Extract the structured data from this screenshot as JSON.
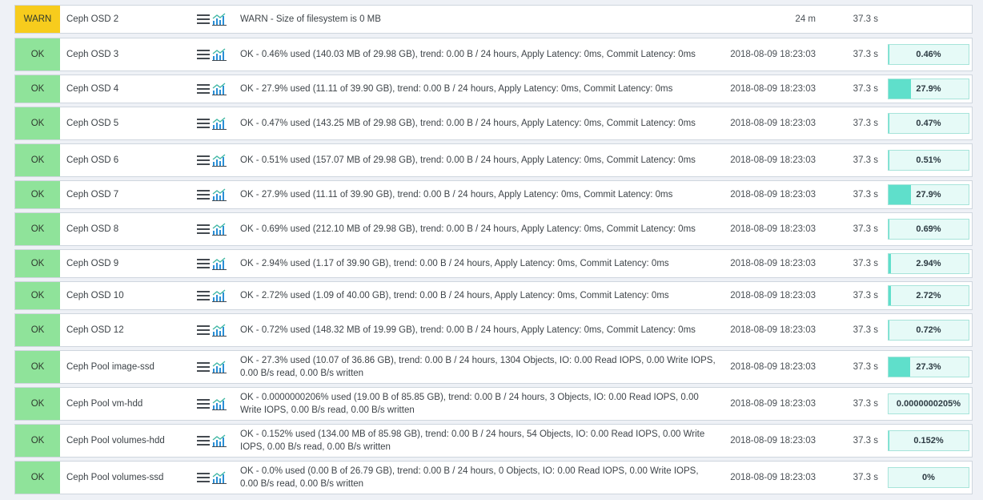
{
  "colors": {
    "ok": "#8fe39a",
    "warn": "#f7cc1d",
    "perf_fill": "#5fdfcb",
    "perf_bg": "#e6faf7"
  },
  "icons": {
    "menu": "hamburger-menu-icon",
    "perf": "perfometer-graph-icon"
  },
  "services": [
    {
      "state": "WARN",
      "name": "Ceph OSD 2",
      "output": "WARN - Size of filesystem is 0 MB",
      "since": "24 m",
      "age": "37.3 s",
      "perf": null
    },
    {
      "state": "OK",
      "name": "Ceph OSD 3",
      "output": "OK - 0.46% used (140.03 MB of 29.98 GB), trend: 0.00 B / 24 hours, Apply Latency: 0ms, Commit Latency: 0ms",
      "since": "2018-08-09 18:23:03",
      "age": "37.3 s",
      "perf": {
        "label": "0.46%",
        "percent": 0.46
      }
    },
    {
      "state": "OK",
      "name": "Ceph OSD 4",
      "output": "OK - 27.9% used (11.11 of 39.90 GB), trend: 0.00 B / 24 hours, Apply Latency: 0ms, Commit Latency: 0ms",
      "since": "2018-08-09 18:23:03",
      "age": "37.3 s",
      "perf": {
        "label": "27.9%",
        "percent": 27.9
      }
    },
    {
      "state": "OK",
      "name": "Ceph OSD 5",
      "output": "OK - 0.47% used (143.25 MB of 29.98 GB), trend: 0.00 B / 24 hours, Apply Latency: 0ms, Commit Latency: 0ms",
      "since": "2018-08-09 18:23:03",
      "age": "37.3 s",
      "perf": {
        "label": "0.47%",
        "percent": 0.47
      }
    },
    {
      "state": "OK",
      "name": "Ceph OSD 6",
      "output": "OK - 0.51% used (157.07 MB of 29.98 GB), trend: 0.00 B / 24 hours, Apply Latency: 0ms, Commit Latency: 0ms",
      "since": "2018-08-09 18:23:03",
      "age": "37.3 s",
      "perf": {
        "label": "0.51%",
        "percent": 0.51
      }
    },
    {
      "state": "OK",
      "name": "Ceph OSD 7",
      "output": "OK - 27.9% used (11.11 of 39.90 GB), trend: 0.00 B / 24 hours, Apply Latency: 0ms, Commit Latency: 0ms",
      "since": "2018-08-09 18:23:03",
      "age": "37.3 s",
      "perf": {
        "label": "27.9%",
        "percent": 27.9
      }
    },
    {
      "state": "OK",
      "name": "Ceph OSD 8",
      "output": "OK - 0.69% used (212.10 MB of 29.98 GB), trend: 0.00 B / 24 hours, Apply Latency: 0ms, Commit Latency: 0ms",
      "since": "2018-08-09 18:23:03",
      "age": "37.3 s",
      "perf": {
        "label": "0.69%",
        "percent": 0.69
      }
    },
    {
      "state": "OK",
      "name": "Ceph OSD 9",
      "output": "OK - 2.94% used (1.17 of 39.90 GB), trend: 0.00 B / 24 hours, Apply Latency: 0ms, Commit Latency: 0ms",
      "since": "2018-08-09 18:23:03",
      "age": "37.3 s",
      "perf": {
        "label": "2.94%",
        "percent": 2.94
      }
    },
    {
      "state": "OK",
      "name": "Ceph OSD 10",
      "output": "OK - 2.72% used (1.09 of 40.00 GB), trend: 0.00 B / 24 hours, Apply Latency: 0ms, Commit Latency: 0ms",
      "since": "2018-08-09 18:23:03",
      "age": "37.3 s",
      "perf": {
        "label": "2.72%",
        "percent": 2.72
      }
    },
    {
      "state": "OK",
      "name": "Ceph OSD 12",
      "output": "OK - 0.72% used (148.32 MB of 19.99 GB), trend: 0.00 B / 24 hours, Apply Latency: 0ms, Commit Latency: 0ms",
      "since": "2018-08-09 18:23:03",
      "age": "37.3 s",
      "perf": {
        "label": "0.72%",
        "percent": 0.72
      }
    },
    {
      "state": "OK",
      "name": "Ceph Pool image-ssd",
      "output": "OK - 27.3% used (10.07 of 36.86 GB), trend: 0.00 B / 24 hours, 1304 Objects, IO: 0.00 Read IOPS, 0.00 Write IOPS, 0.00 B/s read, 0.00 B/s written",
      "since": "2018-08-09 18:23:03",
      "age": "37.3 s",
      "perf": {
        "label": "27.3%",
        "percent": 27.3
      }
    },
    {
      "state": "OK",
      "name": "Ceph Pool vm-hdd",
      "output": "OK - 0.0000000206% used (19.00 B of 85.85 GB), trend: 0.00 B / 24 hours, 3 Objects, IO: 0.00 Read IOPS, 0.00 Write IOPS, 0.00 B/s read, 0.00 B/s written",
      "since": "2018-08-09 18:23:03",
      "age": "37.3 s",
      "perf": {
        "label": "0.0000000205%",
        "percent": 2.05e-08
      }
    },
    {
      "state": "OK",
      "name": "Ceph Pool volumes-hdd",
      "output": "OK - 0.152% used (134.00 MB of 85.98 GB), trend: 0.00 B / 24 hours, 54 Objects, IO: 0.00 Read IOPS, 0.00 Write IOPS, 0.00 B/s read, 0.00 B/s written",
      "since": "2018-08-09 18:23:03",
      "age": "37.3 s",
      "perf": {
        "label": "0.152%",
        "percent": 0.152
      }
    },
    {
      "state": "OK",
      "name": "Ceph Pool volumes-ssd",
      "output": "OK - 0.0% used (0.00 B of 26.79 GB), trend: 0.00 B / 24 hours, 0 Objects, IO: 0.00 Read IOPS, 0.00 Write IOPS, 0.00 B/s read, 0.00 B/s written",
      "since": "2018-08-09 18:23:03",
      "age": "37.3 s",
      "perf": {
        "label": "0%",
        "percent": 0
      }
    }
  ]
}
